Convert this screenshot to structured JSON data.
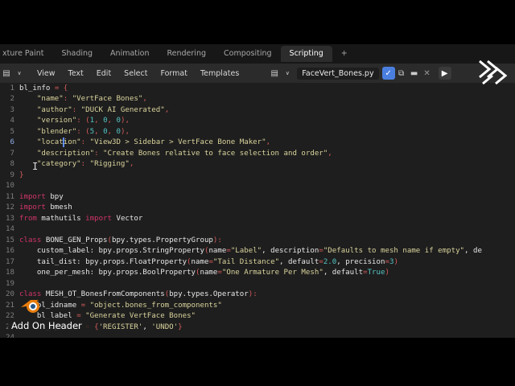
{
  "workspace_tabs": [
    "xture Paint",
    "Shading",
    "Animation",
    "Rendering",
    "Compositing",
    "Scripting"
  ],
  "active_tab": "Scripting",
  "add_tab_label": "+",
  "menus": [
    "View",
    "Text",
    "Edit",
    "Select",
    "Format",
    "Templates"
  ],
  "file_name": "FaceVert_Bones.py",
  "current_line": 6,
  "overlay_label": "Add On Header",
  "colors": {
    "keyword": "#d0346a",
    "string": "#d9d39c",
    "number": "#56c4c4",
    "operator": "#d45b5b",
    "active_tab_bg": "#2c2c2c",
    "shield": "#4a7fe0"
  },
  "code_lines": [
    [
      [
        "t",
        "bl_info "
      ],
      [
        "o",
        "= {"
      ]
    ],
    [
      [
        "s",
        "    \"name\""
      ],
      [
        "o",
        ": "
      ],
      [
        "s",
        "\"VertFace Bones\""
      ],
      [
        "o",
        ","
      ]
    ],
    [
      [
        "s",
        "    \"author\""
      ],
      [
        "o",
        ": "
      ],
      [
        "s",
        "\"DUCK AI Generated\""
      ],
      [
        "o",
        ","
      ]
    ],
    [
      [
        "s",
        "    \"version\""
      ],
      [
        "o",
        ": ("
      ],
      [
        "n",
        "1"
      ],
      [
        "o",
        ", "
      ],
      [
        "n",
        "0"
      ],
      [
        "o",
        ", "
      ],
      [
        "n",
        "0"
      ],
      [
        "o",
        "),"
      ]
    ],
    [
      [
        "s",
        "    \"blender\""
      ],
      [
        "o",
        ": ("
      ],
      [
        "n",
        "5"
      ],
      [
        "o",
        ", "
      ],
      [
        "n",
        "0"
      ],
      [
        "o",
        ", "
      ],
      [
        "n",
        "0"
      ],
      [
        "o",
        "),"
      ]
    ],
    [
      [
        "s",
        "    \"location\""
      ],
      [
        "o",
        ": "
      ],
      [
        "s",
        "\"View3D > Sidebar > VertFace Bone Maker\""
      ],
      [
        "o",
        ","
      ]
    ],
    [
      [
        "s",
        "    \"description\""
      ],
      [
        "o",
        ": "
      ],
      [
        "s",
        "\"Create Bones relative to face selection and order\""
      ],
      [
        "o",
        ","
      ]
    ],
    [
      [
        "s",
        "    \"category\""
      ],
      [
        "o",
        ": "
      ],
      [
        "s",
        "\"Rigging\""
      ],
      [
        "o",
        ","
      ]
    ],
    [
      [
        "o",
        "}"
      ]
    ],
    [],
    [
      [
        "k",
        "import"
      ],
      [
        "t",
        " bpy"
      ]
    ],
    [
      [
        "k",
        "import"
      ],
      [
        "t",
        " bmesh"
      ]
    ],
    [
      [
        "k",
        "from"
      ],
      [
        "t",
        " mathutils "
      ],
      [
        "k",
        "import"
      ],
      [
        "t",
        " Vector"
      ]
    ],
    [],
    [
      [
        "k",
        "class"
      ],
      [
        "t",
        " BONE_GEN_Props"
      ],
      [
        "o",
        "("
      ],
      [
        "t",
        "bpy.types.PropertyGroup"
      ],
      [
        "o",
        "):"
      ]
    ],
    [
      [
        "t",
        "    custom_label: bpy.props.StringProperty"
      ],
      [
        "o",
        "("
      ],
      [
        "t",
        "name"
      ],
      [
        "o",
        "="
      ],
      [
        "s",
        "\"Label\""
      ],
      [
        "t",
        ", description"
      ],
      [
        "o",
        "="
      ],
      [
        "s",
        "\"Defaults to mesh name if empty\""
      ],
      [
        "t",
        ", de"
      ]
    ],
    [
      [
        "t",
        "    tail_dist: bpy.props.FloatProperty"
      ],
      [
        "o",
        "("
      ],
      [
        "t",
        "name"
      ],
      [
        "o",
        "="
      ],
      [
        "s",
        "\"Tail Distance\""
      ],
      [
        "t",
        ", default"
      ],
      [
        "o",
        "="
      ],
      [
        "n",
        "2.0"
      ],
      [
        "t",
        ", precision"
      ],
      [
        "o",
        "="
      ],
      [
        "n",
        "3"
      ],
      [
        "o",
        ")"
      ]
    ],
    [
      [
        "t",
        "    one_per_mesh: bpy.props.BoolProperty"
      ],
      [
        "o",
        "("
      ],
      [
        "t",
        "name"
      ],
      [
        "o",
        "="
      ],
      [
        "s",
        "\"One Armature Per Mesh\""
      ],
      [
        "t",
        ", default"
      ],
      [
        "o",
        "="
      ],
      [
        "n",
        "True"
      ],
      [
        "o",
        ")"
      ]
    ],
    [],
    [
      [
        "k",
        "class"
      ],
      [
        "t",
        " MESH_OT_BonesFromComponents"
      ],
      [
        "o",
        "("
      ],
      [
        "t",
        "bpy.types.Operator"
      ],
      [
        "o",
        "):"
      ]
    ],
    [
      [
        "t",
        "    bl_idname "
      ],
      [
        "o",
        "= "
      ],
      [
        "s",
        "\"object.bones_from_components\""
      ]
    ],
    [
      [
        "t",
        "    bl_label "
      ],
      [
        "o",
        "= "
      ],
      [
        "s",
        "\"Generate VertFace Bones\""
      ]
    ],
    [
      [
        "t",
        "    bl_options "
      ],
      [
        "o",
        "= {"
      ],
      [
        "s",
        "'REGISTER'"
      ],
      [
        "t",
        ", "
      ],
      [
        "s",
        "'UNDO'"
      ],
      [
        "o",
        "}"
      ]
    ],
    []
  ]
}
